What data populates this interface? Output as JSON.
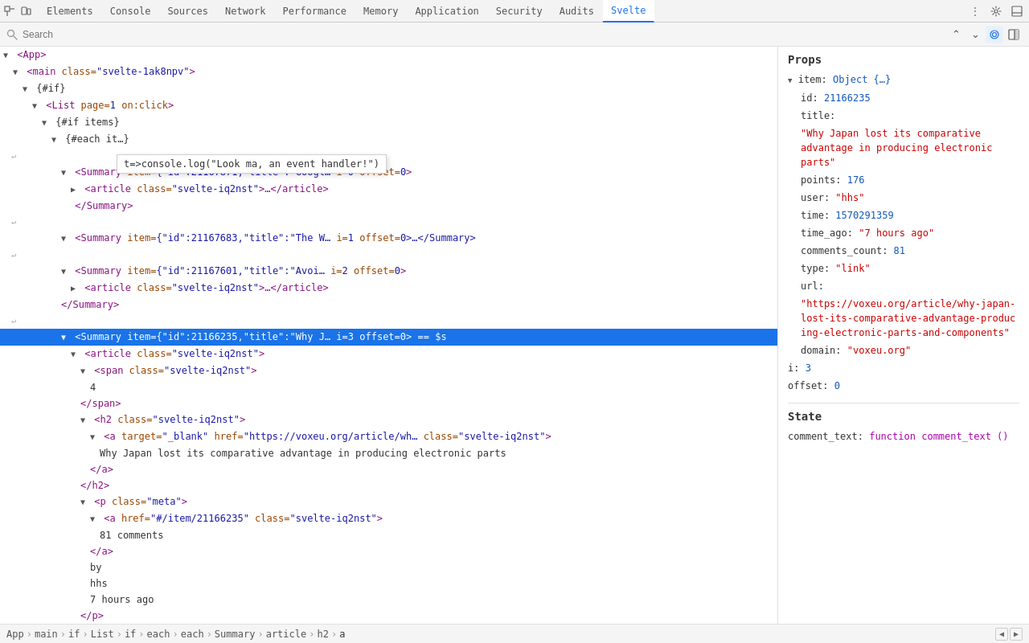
{
  "tabs": {
    "items": [
      {
        "label": "Elements",
        "active": false
      },
      {
        "label": "Console",
        "active": false
      },
      {
        "label": "Sources",
        "active": false
      },
      {
        "label": "Network",
        "active": false
      },
      {
        "label": "Performance",
        "active": false
      },
      {
        "label": "Memory",
        "active": false
      },
      {
        "label": "Application",
        "active": false
      },
      {
        "label": "Security",
        "active": false
      },
      {
        "label": "Audits",
        "active": false
      },
      {
        "label": "Svelte",
        "active": true
      }
    ]
  },
  "search": {
    "placeholder": "Search"
  },
  "props": {
    "section_title": "Props",
    "item_label": "item:",
    "item_type": "Object {…}",
    "id_label": "id:",
    "id_value": "21166235",
    "title_label": "title:",
    "title_value": "\"Why Japan lost its comparative advantage in producing electronic parts\"",
    "points_label": "points:",
    "points_value": "176",
    "user_label": "user:",
    "user_value": "\"hhs\"",
    "time_label": "time:",
    "time_value": "1570291359",
    "time_ago_label": "time_ago:",
    "time_ago_value": "\"7 hours ago\"",
    "comments_count_label": "comments_count:",
    "comments_count_value": "81",
    "type_label": "type:",
    "type_value": "\"link\"",
    "url_label": "url:",
    "url_value": "\"https://voxeu.org/article/why-japan-lost-its-comparative-advantage-producing-electronic-parts-and-components\"",
    "domain_label": "domain:",
    "domain_value": "\"voxeu.org\"",
    "i_label": "i:",
    "i_value": "3",
    "offset_label": "offset:",
    "offset_value": "0"
  },
  "state": {
    "section_title": "State",
    "comment_text_label": "comment_text:",
    "comment_text_value": "function comment_text ()"
  },
  "breadcrumb": {
    "items": [
      "App",
      "main",
      "if",
      "List",
      "if",
      "each",
      "each",
      "Summary",
      "article",
      "h2",
      "a"
    ]
  },
  "tooltip": {
    "text": "t=>console.log(\"Look ma, an event handler!\")"
  }
}
